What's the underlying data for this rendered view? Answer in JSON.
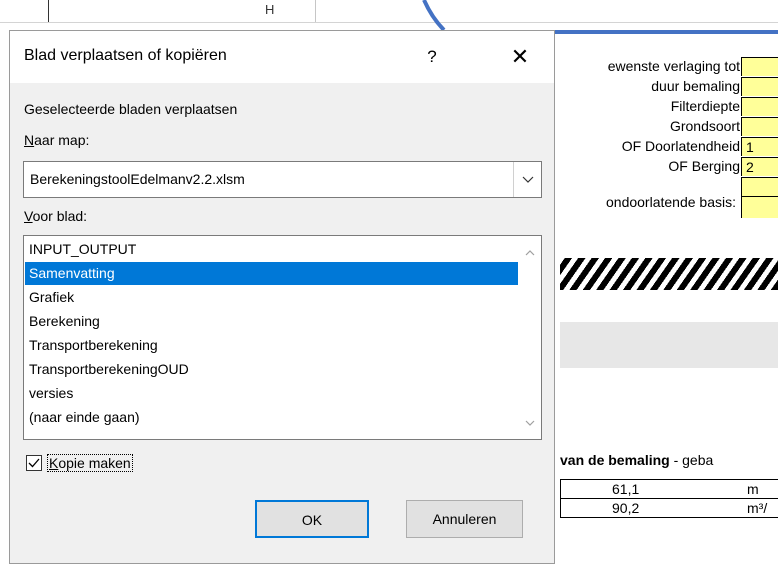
{
  "spreadsheet": {
    "column_letter": "H",
    "labels": [
      "ewenste verlaging tot",
      "duur bemaling",
      "Filterdiepte",
      "Grondsoort",
      "OF Doorlatendheid",
      "OF Berging",
      "ondoorlatende basis:"
    ],
    "yellow_values": [
      "",
      "",
      "",
      "",
      "1",
      "2",
      "",
      ""
    ],
    "section_title_bold": "van de bemaling",
    "section_title_rest": " - geba",
    "rows": [
      {
        "value": "61,1",
        "unit": "m"
      },
      {
        "value": "90,2",
        "unit": "m³/"
      }
    ],
    "colors": {
      "yellow": "#ffff99",
      "blue_line": "#4472c4"
    }
  },
  "dialog": {
    "title": "Blad verplaatsen of kopiëren",
    "help_label": "?",
    "close_label": "✕",
    "subtitle": "Geselecteerde bladen verplaatsen",
    "to_book_label_accel": "N",
    "to_book_label_rest": "aar map:",
    "to_book_value": "BerekeningstoolEdelmanv2.2.xlsm",
    "before_sheet_label_accel": "V",
    "before_sheet_label_rest": "oor blad:",
    "sheets": [
      "INPUT_OUTPUT",
      "Samenvatting",
      "Grafiek",
      "Berekening",
      "Transportberekening",
      "TransportberekeningOUD",
      "versies",
      "(naar einde gaan)"
    ],
    "selected_sheet": "Samenvatting",
    "copy_label_accel": "K",
    "copy_label_rest": "opie maken",
    "copy_checked": true,
    "ok_label": "OK",
    "cancel_label": "Annuleren",
    "colors": {
      "selection": "#0078d7",
      "dialog_bg": "#f0f0f0"
    }
  }
}
